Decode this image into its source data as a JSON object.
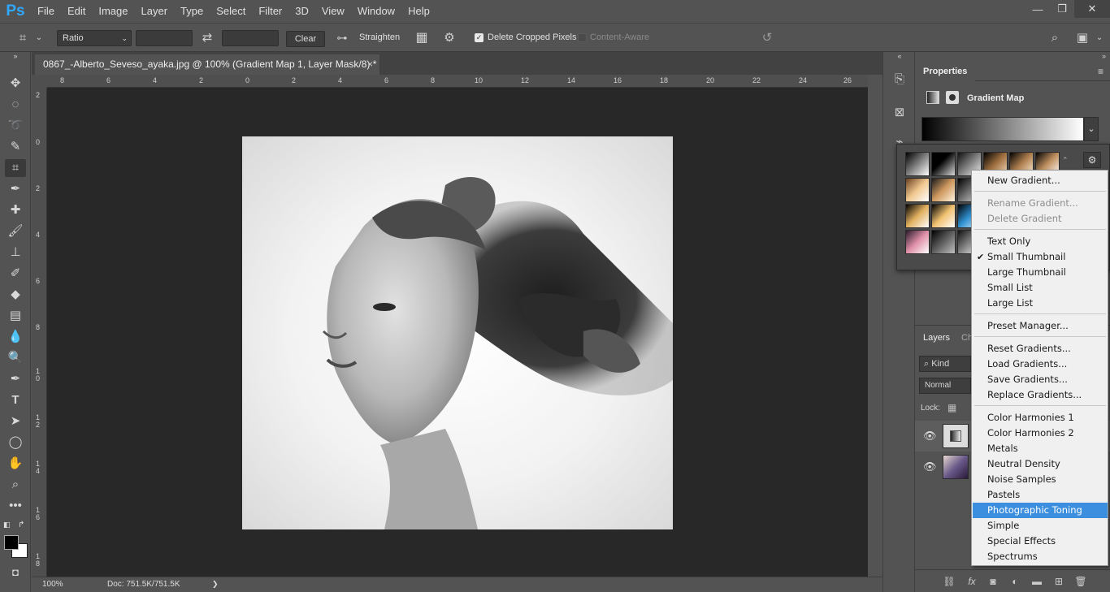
{
  "app": {
    "logo": "Ps"
  },
  "menubar": [
    "File",
    "Edit",
    "Image",
    "Layer",
    "Type",
    "Select",
    "Filter",
    "3D",
    "View",
    "Window",
    "Help"
  ],
  "window_controls": {
    "minimize": "—",
    "restore": "❐",
    "close": "✕"
  },
  "options": {
    "ratio_select": "Ratio",
    "clear_label": "Clear",
    "straighten_label": "Straighten",
    "delete_cropped_label": "Delete Cropped Pixels",
    "delete_cropped_checked": true,
    "content_aware_label": "Content-Aware",
    "content_aware_checked": false
  },
  "document": {
    "tab_title": "0867_-Alberto_Seveso_ayaka.jpg @ 100% (Gradient Map 1, Layer Mask/8) *",
    "close_glyph": "×",
    "ruler_top": [
      "8",
      "6",
      "4",
      "2",
      "0",
      "2",
      "4",
      "6",
      "8",
      "10",
      "12",
      "14",
      "16",
      "18",
      "20",
      "22",
      "24",
      "26"
    ],
    "ruler_left": [
      "2",
      "0",
      "2",
      "4",
      "6",
      "8",
      "1 0",
      "1 2",
      "1 4",
      "1 6",
      "1 8"
    ],
    "zoom": "100%",
    "doc_info": "Doc: 751.5K/751.5K",
    "status_arrow": "❯"
  },
  "properties": {
    "tab": "Properties",
    "adjustment_title": "Gradient Map",
    "dropdown_glyph": "⌄"
  },
  "layers": {
    "tab_layers": "Layers",
    "tab_channels": "Ch",
    "kind_filter": "Kind",
    "blend_mode": "Normal",
    "lock_label": "Lock:"
  },
  "context_menu": {
    "items": [
      {
        "label": "New Gradient...",
        "disabled": false
      },
      {
        "label": "Rename Gradient...",
        "disabled": true
      },
      {
        "label": "Delete Gradient",
        "disabled": true
      },
      {
        "label": "Text Only",
        "disabled": false
      },
      {
        "label": "Small Thumbnail",
        "disabled": false,
        "checked": true
      },
      {
        "label": "Large Thumbnail",
        "disabled": false
      },
      {
        "label": "Small List",
        "disabled": false
      },
      {
        "label": "Large List",
        "disabled": false
      },
      {
        "label": "Preset Manager...",
        "disabled": false
      },
      {
        "label": "Reset Gradients...",
        "disabled": false
      },
      {
        "label": "Load Gradients...",
        "disabled": false
      },
      {
        "label": "Save Gradients...",
        "disabled": false
      },
      {
        "label": "Replace Gradients...",
        "disabled": false
      },
      {
        "label": "Color Harmonies 1",
        "disabled": false
      },
      {
        "label": "Color Harmonies 2",
        "disabled": false
      },
      {
        "label": "Metals",
        "disabled": false
      },
      {
        "label": "Neutral Density",
        "disabled": false
      },
      {
        "label": "Noise Samples",
        "disabled": false
      },
      {
        "label": "Pastels",
        "disabled": false
      },
      {
        "label": "Photographic Toning",
        "disabled": false,
        "highlighted": true
      },
      {
        "label": "Simple",
        "disabled": false
      },
      {
        "label": "Special Effects",
        "disabled": false
      },
      {
        "label": "Spectrums",
        "disabled": false
      }
    ],
    "check_glyph": "✔"
  },
  "colors": {
    "accent": "#31a8ff",
    "menu_highlight": "#3c8ede",
    "ui_bg": "#535353",
    "canvas_bg": "#282828"
  }
}
